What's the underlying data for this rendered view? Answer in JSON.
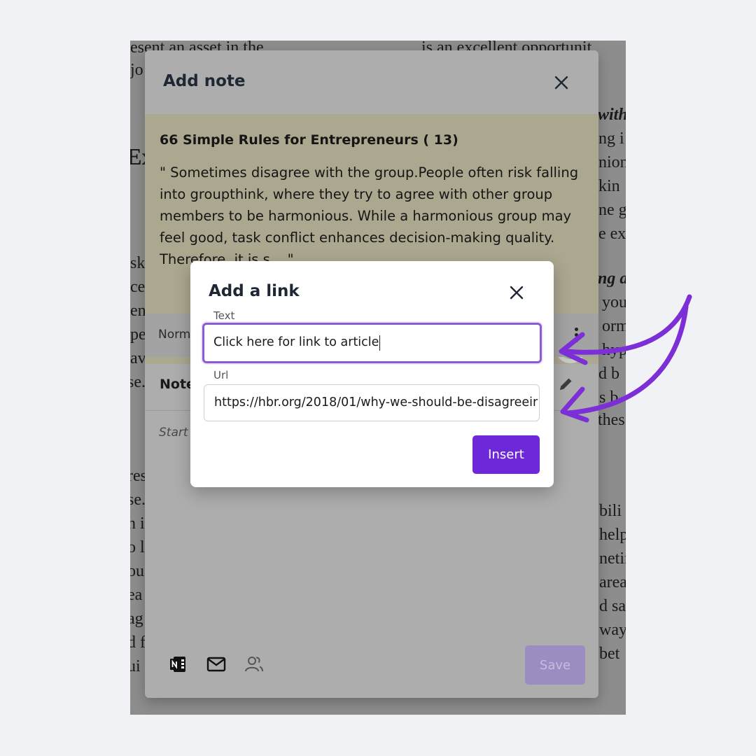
{
  "document": {
    "lines": [
      "esent an asset in the",
      "is an excellent opportunit",
      "jo",
      "with",
      "ng i",
      "Ex",
      "nion",
      "kin",
      "ne g",
      "e exp",
      "sk",
      "ng a",
      "ce",
      "you",
      "en",
      "orm",
      "pe",
      "hyp",
      "av",
      "d b",
      "se.",
      "s b",
      "thes",
      "res",
      "se.",
      "bili",
      "n i",
      "help",
      "o l",
      "netin",
      "ou",
      "area",
      "ea",
      "d sa",
      "ag",
      "way",
      "d f",
      "bet",
      "ui"
    ]
  },
  "note_panel": {
    "title": "Add note",
    "quote_title": "66 Simple Rules for Entrepreneurs ( 13)",
    "quote_text": "\" Sometimes disagree with the group.People often risk falling into groupthink, where they try to agree with other group members to be harmonious. While a harmonious group may feel good, task conflict enhances decision-making quality. Therefore, it is s... \"",
    "highlight_color": "#7abf6a",
    "format_label": "Norm",
    "notes_label": "Note",
    "placeholder": "Start t",
    "save_label": "Save",
    "footer_icons": [
      "onenote-icon",
      "mail-icon",
      "share-users-icon"
    ]
  },
  "link_modal": {
    "title": "Add a link",
    "text_label": "Text",
    "text_value": "Click here for link to article",
    "url_label": "Url",
    "url_value": "https://hbr.org/2018/01/why-we-should-be-disagreeir",
    "insert_label": "Insert"
  },
  "colors": {
    "accent": "#6d28d9",
    "focus_border": "#8b5bd6",
    "arrow": "#7c2fd6"
  }
}
